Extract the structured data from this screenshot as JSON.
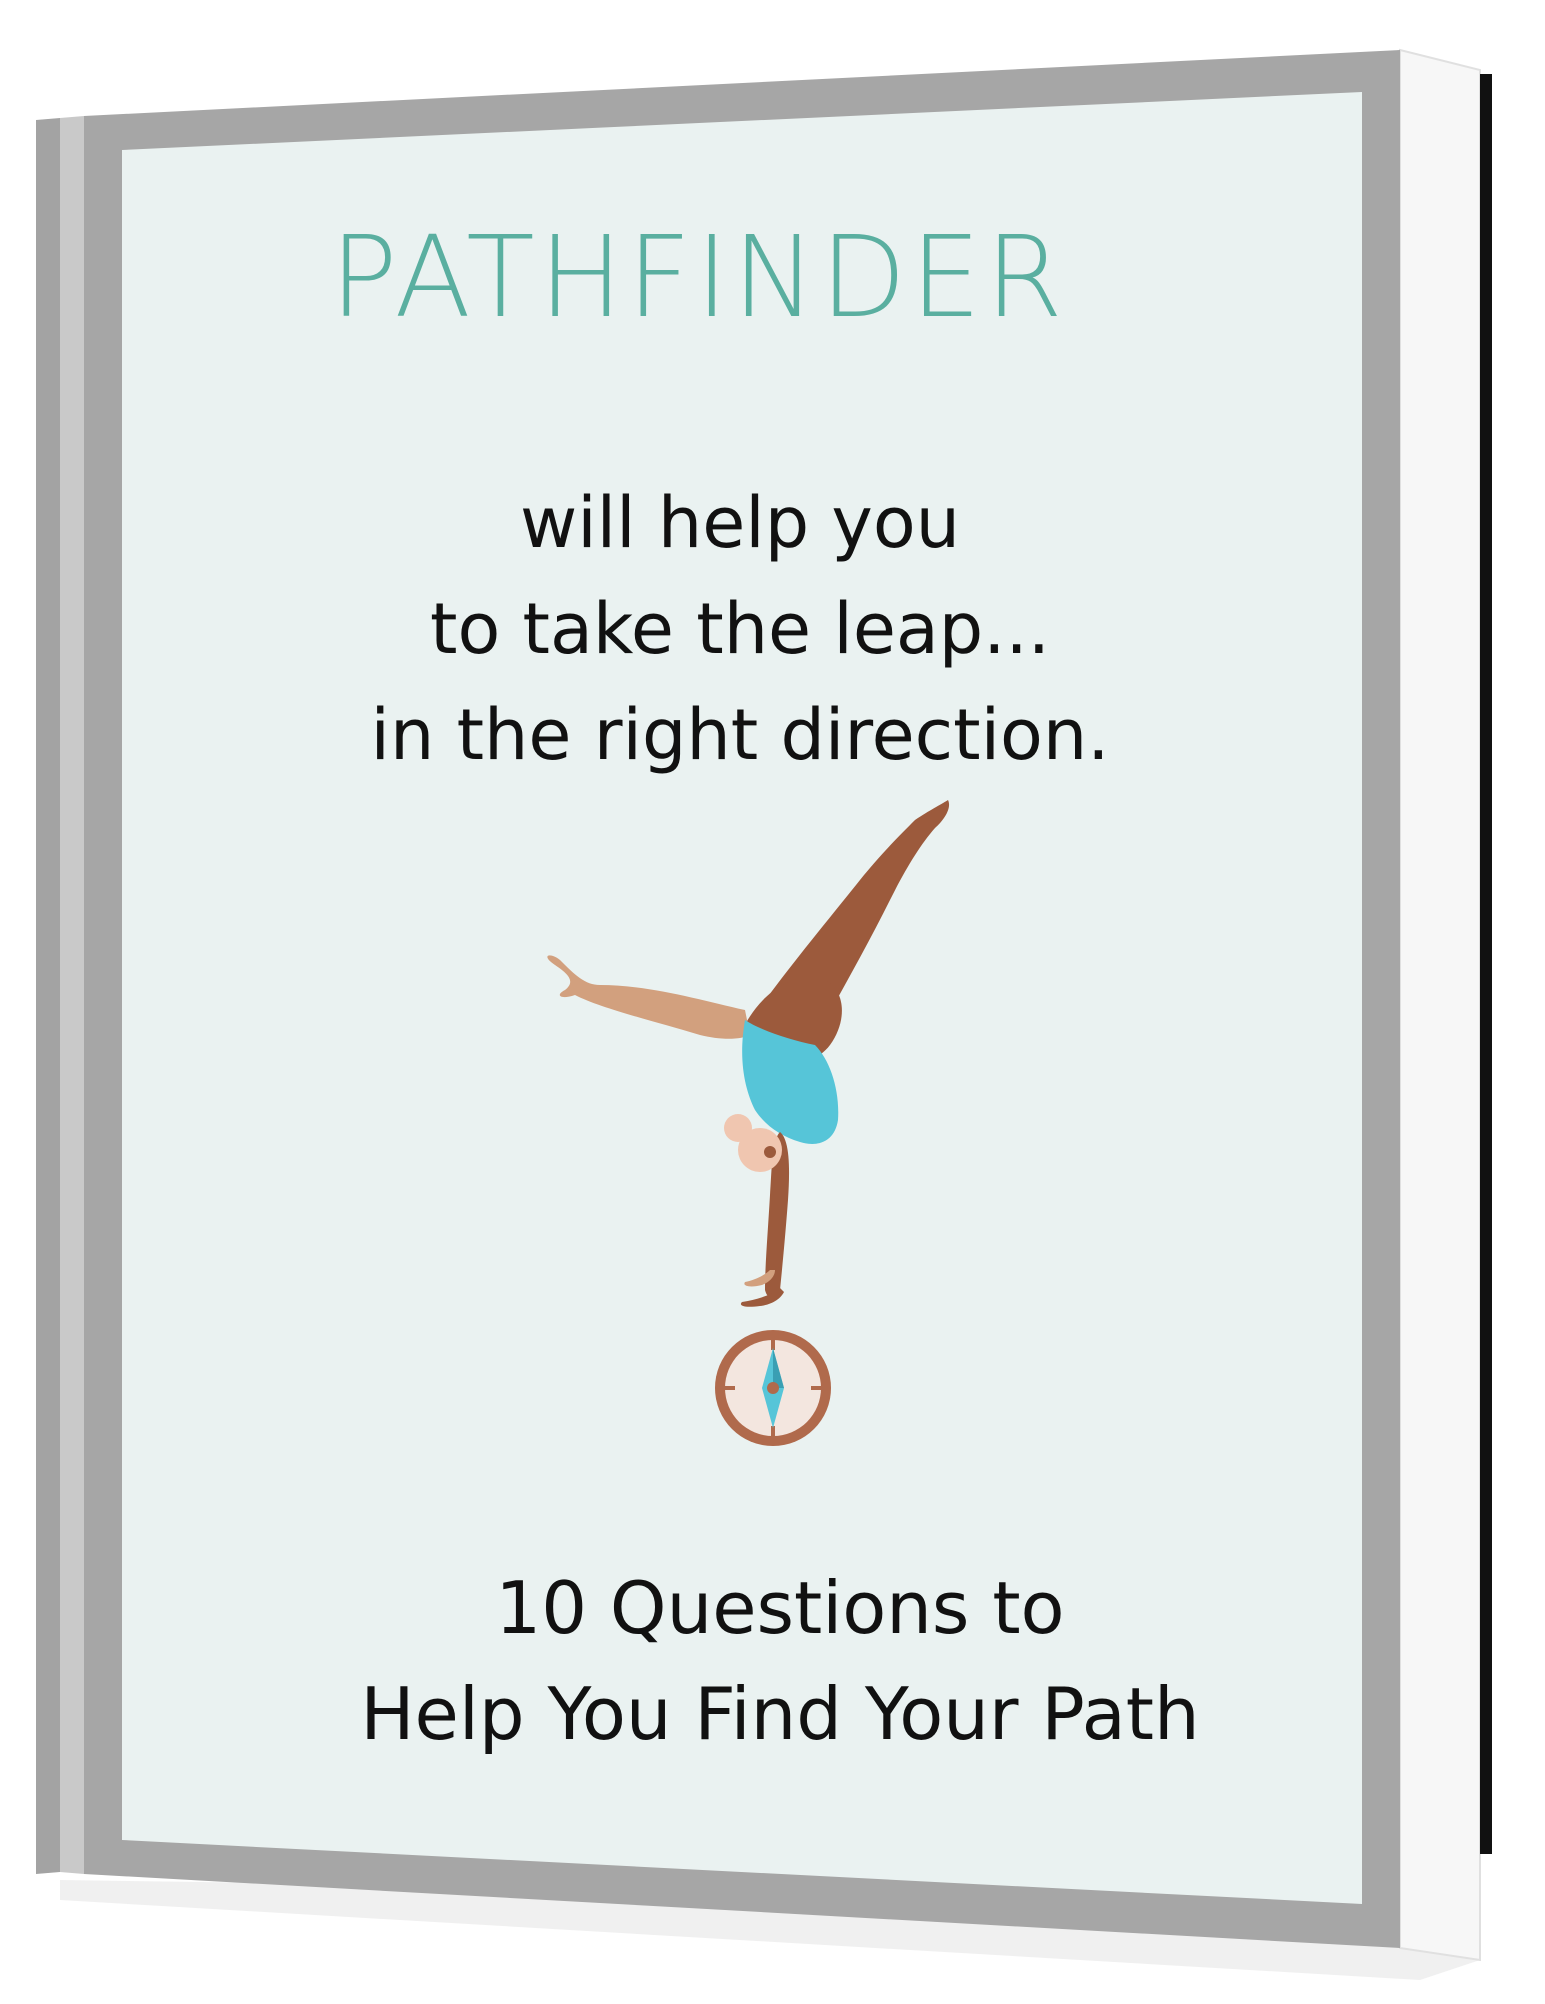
{
  "cover": {
    "title": "PATHFINDER",
    "tagline": [
      "will help you",
      "to take the leap...",
      "in the right direction."
    ],
    "subtitle": [
      "10 Questions to",
      "Help You Find Your Path"
    ]
  },
  "illustration": {
    "figure": "gymnast-handstand-icon",
    "emblem": "compass-icon"
  },
  "colors": {
    "title": "#5aafa0",
    "text": "#111111",
    "cover_background": "#eaf2f1",
    "frame": "#a6a6a6",
    "leotard": "#56c5d8",
    "skin_dark": "#9c5a3c",
    "skin_light": "#d2a07e",
    "compass_ring": "#b06a4c"
  }
}
